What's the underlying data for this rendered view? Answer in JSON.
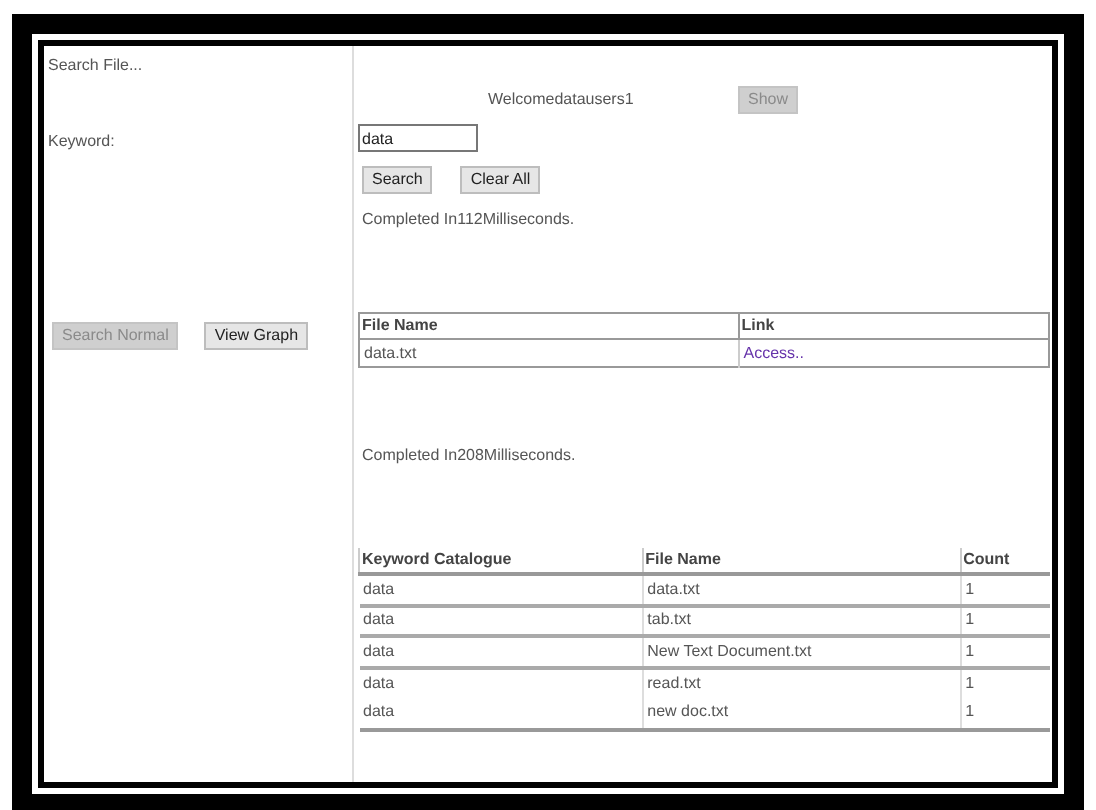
{
  "sidebar": {
    "title": "Search File...",
    "keyword_label": "Keyword:",
    "buttons": [
      {
        "label": "Search Normal",
        "disabled": true
      },
      {
        "label": "View Graph",
        "disabled": false
      }
    ]
  },
  "header": {
    "welcome": "Welcomedatausers1",
    "show_button": {
      "label": "Show",
      "disabled": true
    }
  },
  "search": {
    "value": "data",
    "buttons": [
      "Search",
      "Clear All"
    ],
    "status": "Completed In112Milliseconds."
  },
  "files_table": {
    "columns": [
      "File Name",
      "Link"
    ],
    "rows": [
      {
        "file": "data.txt",
        "link": "Access.."
      }
    ]
  },
  "status_2": "Completed In208Milliseconds.",
  "keyword_table": {
    "columns": [
      "Keyword Catalogue",
      "File Name",
      "Count"
    ],
    "rows": [
      {
        "keyword": "data",
        "file": "data.txt",
        "count": "1"
      },
      {
        "keyword": "data",
        "file": "tab.txt",
        "count": "1"
      },
      {
        "keyword": "data",
        "file": "New Text Document.txt",
        "count": "1"
      },
      {
        "keyword": "data",
        "file": "read.txt",
        "count": "1"
      },
      {
        "keyword": "data",
        "file": "new doc.txt",
        "count": "1"
      }
    ]
  }
}
